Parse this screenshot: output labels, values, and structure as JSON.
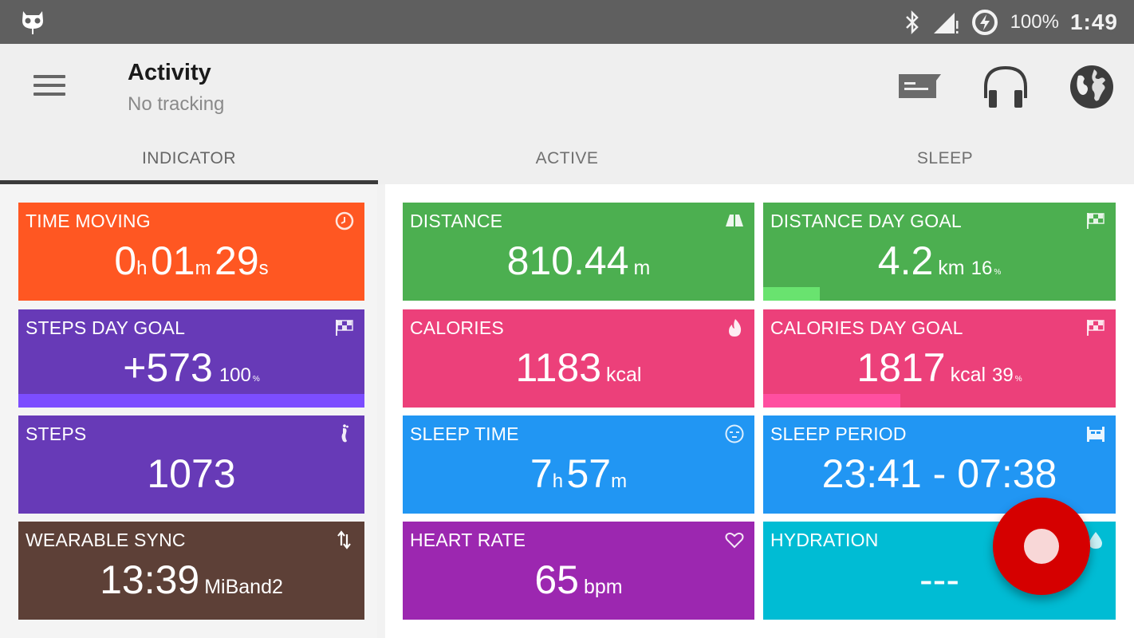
{
  "status_bar": {
    "app_icon": "owl-icon",
    "icons": [
      "bluetooth-icon",
      "signal-icon",
      "battery-saver-icon"
    ],
    "battery": "100%",
    "time": "1:49"
  },
  "toolbar": {
    "menu_icon": "hamburger-menu-icon",
    "title": "Activity",
    "subtitle": "No tracking",
    "actions": [
      "message-icon",
      "headphones-icon",
      "globe-icon"
    ]
  },
  "tabs": [
    {
      "label": "INDICATOR",
      "active": true
    },
    {
      "label": "ACTIVE",
      "active": false
    },
    {
      "label": "SLEEP",
      "active": false
    }
  ],
  "colors": {
    "orange": "#ff5722",
    "deep_purple": "#673ab7",
    "brown": "#5d4037",
    "green": "#4caf50",
    "pink": "#ec407a",
    "blue": "#2196f3",
    "purple": "#9c27b0",
    "cyan": "#00bcd4",
    "fab_red": "#d50000"
  },
  "cards": {
    "time_moving": {
      "label": "TIME MOVING",
      "icon": "clock-icon",
      "h": "0",
      "h_unit": "h",
      "m": "01",
      "m_unit": "m",
      "s": "29",
      "s_unit": "s"
    },
    "steps_day_goal": {
      "label": "STEPS DAY GOAL",
      "icon": "checkered-flag-icon",
      "value": "+573",
      "percent": "100",
      "percent_sign": "%",
      "progress": 1.0
    },
    "steps": {
      "label": "STEPS",
      "icon": "footprint-icon",
      "value": "1073"
    },
    "wearable_sync": {
      "label": "WEARABLE SYNC",
      "icon": "sync-arrows-icon",
      "value": "13:39",
      "device": "MiBand2"
    },
    "distance": {
      "label": "DISTANCE",
      "icon": "road-icon",
      "value": "810.44",
      "unit": "m"
    },
    "distance_day_goal": {
      "label": "DISTANCE DAY GOAL",
      "icon": "checkered-flag-icon",
      "value": "4.2",
      "unit": "km",
      "percent": "16",
      "percent_sign": "%",
      "progress": 0.16
    },
    "calories": {
      "label": "CALORIES",
      "icon": "flame-icon",
      "value": "1183",
      "unit": "kcal"
    },
    "calories_day_goal": {
      "label": "CALORIES DAY GOAL",
      "icon": "checkered-flag-icon",
      "value": "1817",
      "unit": "kcal",
      "percent": "39",
      "percent_sign": "%",
      "progress": 0.39
    },
    "sleep_time": {
      "label": "SLEEP TIME",
      "icon": "sleeping-face-icon",
      "h": "7",
      "h_unit": "h",
      "m": "57",
      "m_unit": "m"
    },
    "sleep_period": {
      "label": "SLEEP PERIOD",
      "icon": "bed-icon",
      "value": "23:41 - 07:38"
    },
    "heart_rate": {
      "label": "HEART RATE",
      "icon": "heart-icon",
      "value": "65",
      "unit": "bpm"
    },
    "hydration": {
      "label": "HYDRATION",
      "icon": "water-drop-icon",
      "value": "---"
    }
  },
  "fab": {
    "icon": "record-icon"
  }
}
